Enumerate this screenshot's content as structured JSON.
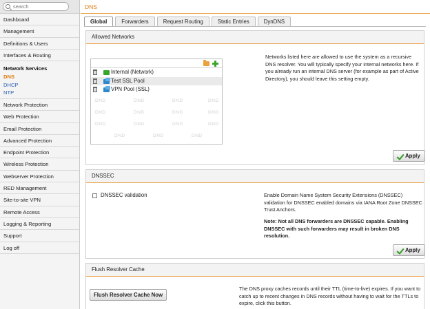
{
  "sidebar": {
    "search_placeholder": "search",
    "items_top": [
      "Dashboard",
      "Management",
      "Definitions & Users",
      "Interfaces & Routing"
    ],
    "active_group": "Network Services",
    "sub_items": [
      "DNS",
      "DHCP",
      "NTP"
    ],
    "items_bottom": [
      "Network Protection",
      "Web Protection",
      "Email Protection",
      "Advanced Protection",
      "Endpoint Protection",
      "Wireless Protection",
      "Webserver Protection",
      "RED Management",
      "Site-to-site VPN",
      "Remote Access",
      "Logging & Reporting",
      "Support",
      "Log off"
    ]
  },
  "header": {
    "title": "DNS"
  },
  "tabs": [
    "Global",
    "Forwarders",
    "Request Routing",
    "Static Entries",
    "DynDNS"
  ],
  "allowed_networks": {
    "title": "Allowed Networks",
    "rows": [
      "Internal (Network)",
      "Test SSL Pool",
      "VPN Pool (SSL)"
    ],
    "watermark": "DND",
    "description": "Networks listed here are allowed to use the system as a recursive DNS resolver. You will typically specify your internal networks here. If you already run an internal DNS server (for example as part of Active Directory), you should leave this setting empty.",
    "apply_label": "Apply"
  },
  "dnssec": {
    "title": "DNSSEC",
    "checkbox_label": "DNSSEC validation",
    "description": "Enable Domain Name System Security Extensions (DNSSEC) validation for DNSSEC enabled domains via IANA Root Zone DNSSEC Trust Anchors.",
    "note": "Note: Not all DNS forwarders are DNSSEC capable. Enabling DNSSEC with such forwarders may result in broken DNS resolution.",
    "apply_label": "Apply"
  },
  "flush": {
    "title": "Flush Resolver Cache",
    "button_label": "Flush Resolver Cache Now",
    "description": "The DNS proxy caches records until their TTL (time-to-live) expires. If you want to catch up to recent changes in DNS records without having to wait for the TTLs to expire, click this button."
  },
  "colors": {
    "accent": "#e07a10",
    "link": "#2a5db0",
    "panel_line": "#e9a24a"
  }
}
